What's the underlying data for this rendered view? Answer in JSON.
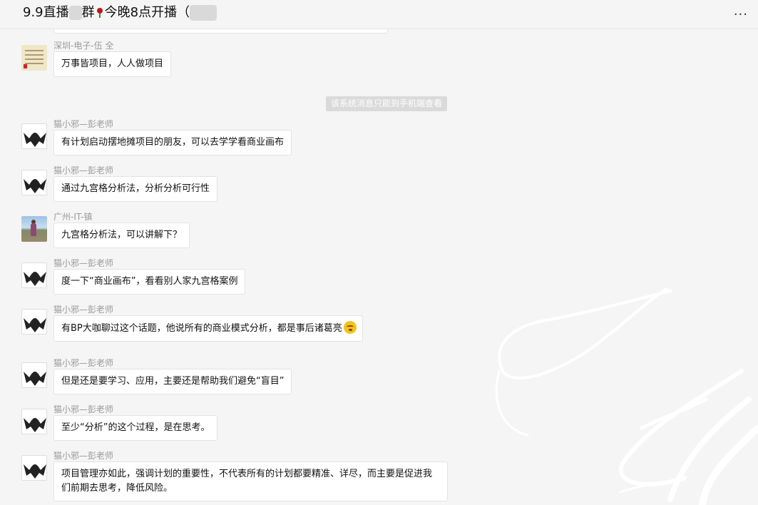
{
  "header": {
    "title_part1": "9.9直播",
    "title_part2": "群",
    "title_part3": "今晚8点开播（",
    "more_label": "..."
  },
  "system_message": "该系统消息只能到手机端查看",
  "messages": [
    {
      "sender": "深圳-电子-伍 全",
      "text": "万事皆项目，人人做项目",
      "avatar": "calligraphy-avatar"
    },
    {
      "sender": "猫小邪—彭老师",
      "text": "有计划启动摆地摊项目的朋友，可以去学学看商业画布",
      "avatar": "bat-avatar"
    },
    {
      "sender": "猫小邪—彭老师",
      "text": "通过九宫格分析法，分析分析可行性",
      "avatar": "bat-avatar"
    },
    {
      "sender": "广州-IT-镇",
      "text": "九宫格分析法，可以讲解下？",
      "avatar": "beach-avatar"
    },
    {
      "sender": "猫小邪—彭老师",
      "text": "度一下“商业画布”，看看别人家九宫格案例",
      "avatar": "bat-avatar"
    },
    {
      "sender": "猫小邪—彭老师",
      "text": "有BP大咖聊过这个话题，他说所有的商业模式分析，都是事后诸葛亮",
      "avatar": "bat-avatar"
    },
    {
      "sender": "猫小邪—彭老师",
      "text": "但是还是要学习、应用，主要还是帮助我们避免“盲目”",
      "avatar": "bat-avatar"
    },
    {
      "sender": "猫小邪—彭老师",
      "text": "至少“分析”的这个过程，是在思考。",
      "avatar": "bat-avatar"
    },
    {
      "sender": "猫小邪—彭老师",
      "text": "项目管理亦如此，强调计划的重要性，不代表所有的计划都要精准、详尽，而主要是促进我们前期去思考，降低风险。",
      "avatar": "bat-avatar"
    }
  ],
  "colors": {
    "background": "#f5f5f5",
    "bubble": "#ffffff",
    "sender": "#999999",
    "system_badge": "#dadada"
  }
}
